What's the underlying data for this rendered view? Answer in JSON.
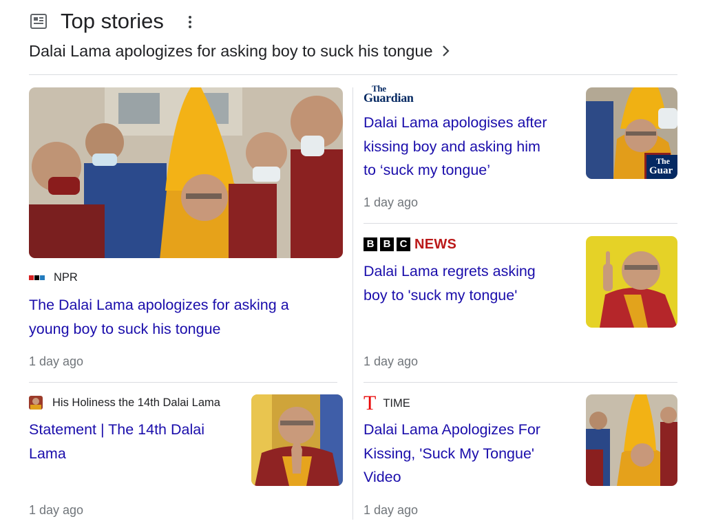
{
  "header": {
    "title": "Top stories",
    "icon": "newspaper-icon",
    "menu_icon": "more-vert-icon"
  },
  "topic": {
    "text": "Dalai Lama apologizes for asking boy to suck his tongue",
    "icon": "chevron-right-icon"
  },
  "colors": {
    "link": "#1a0dab",
    "meta": "#70757a",
    "divider": "#dadce0",
    "bbc_news_red": "#bb1919",
    "time_red": "#e90606",
    "guardian_navy": "#052962"
  },
  "stories": [
    {
      "source": "NPR",
      "headline_line1": "The Dalai Lama apologizes for asking a",
      "headline_line2": "young boy to suck his tongue",
      "time": "1 day ago"
    },
    {
      "source": "The Guardian",
      "source_logo_line1": "The",
      "source_logo_line2": "Guardian",
      "thumb_badge_line1": "The",
      "thumb_badge_line2": "Guar",
      "headline_line1": "Dalai Lama apologises after",
      "headline_line2": "kissing boy and asking him",
      "headline_line3": "to ‘suck my tongue’",
      "time": "1 day ago"
    },
    {
      "source": "BBC NEWS",
      "source_letters": [
        "B",
        "B",
        "C"
      ],
      "source_word": "NEWS",
      "headline_line1": "Dalai Lama regrets asking",
      "headline_line2": "boy to 'suck my tongue'",
      "time": "1 day ago"
    },
    {
      "source": "His Holiness the 14th Dalai Lama",
      "headline_line1": "Statement | The 14th Dalai",
      "headline_line2": "Lama",
      "time": "1 day ago"
    },
    {
      "source": "TIME",
      "source_logo": "T",
      "headline_line1": "Dalai Lama Apologizes For",
      "headline_line2": "Kissing, 'Suck My Tongue'",
      "headline_line3": "Video",
      "time": "1 day ago"
    }
  ]
}
